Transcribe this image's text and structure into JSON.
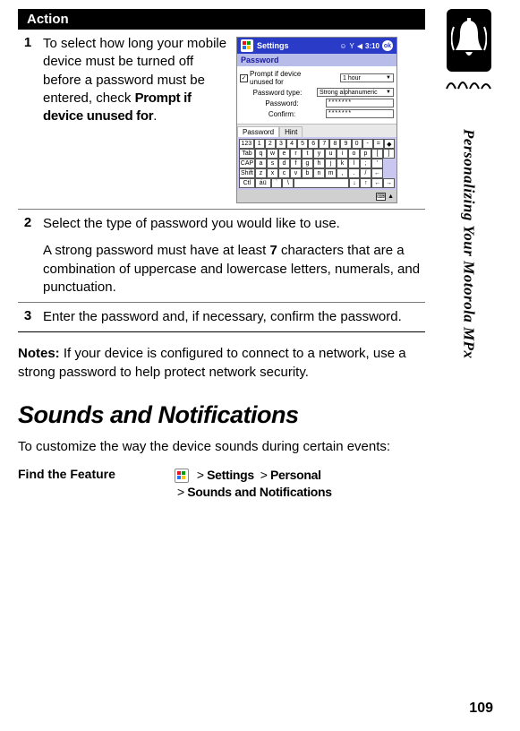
{
  "table": {
    "header": "Action",
    "step1": {
      "num": "1",
      "text_before": "To select how long your mobile device must be turned off before a password must be entered, check ",
      "bold": "Prompt if device unused for",
      "text_after": "."
    },
    "step2": {
      "num": "2",
      "line1": "Select the type of password you would like to use.",
      "line2_a": "A strong password must have at least ",
      "line2_b": "7",
      "line2_c": " characters that are a combination of uppercase and lowercase letters, numerals, and punctuation."
    },
    "step3": {
      "num": "3",
      "text": "Enter the password and, if necessary, confirm the password."
    }
  },
  "notes": {
    "label": "Notes:",
    "text": " If your device is configured to connect to a network, use a strong password to help protect network security."
  },
  "section_title": "Sounds and Notifications",
  "para": "To customize the way the device sounds during certain events:",
  "find_feature": {
    "label": "Find the Feature",
    "gt": ">",
    "p1": "Settings",
    "p2": "Personal",
    "p3": "Sounds and Notifications"
  },
  "side_label": "Personalizing Your Motorola MPx",
  "page_number": "109",
  "screenshot": {
    "titlebar": "Settings",
    "time": "3:10",
    "ok": "ok",
    "subheader": "Password",
    "chk_label": "Prompt if device unused for",
    "dd1": "1 hour",
    "row2_label": "Password type:",
    "dd2": "Strong alphanumeric",
    "row3_label": "Password:",
    "pw": "*******",
    "row4_label": "Confirm:",
    "tab1": "Password",
    "tab2": "Hint",
    "kb_row1": [
      "123",
      "1",
      "2",
      "3",
      "4",
      "5",
      "6",
      "7",
      "8",
      "9",
      "0",
      "-",
      "=",
      "◆"
    ],
    "kb_row2": [
      "Tab",
      "q",
      "w",
      "e",
      "r",
      "t",
      "y",
      "u",
      "i",
      "o",
      "p",
      "[",
      "]"
    ],
    "kb_row3": [
      "CAP",
      "a",
      "s",
      "d",
      "f",
      "g",
      "h",
      "j",
      "k",
      "l",
      ";",
      "'"
    ],
    "kb_row4": [
      "Shift",
      "z",
      "x",
      "c",
      "v",
      "b",
      "n",
      "m",
      ",",
      ".",
      "/",
      "←"
    ],
    "kb_row5": [
      "Ctl",
      "áü",
      "`",
      "\\",
      " ",
      "↓",
      "↑",
      "←",
      "→"
    ]
  }
}
